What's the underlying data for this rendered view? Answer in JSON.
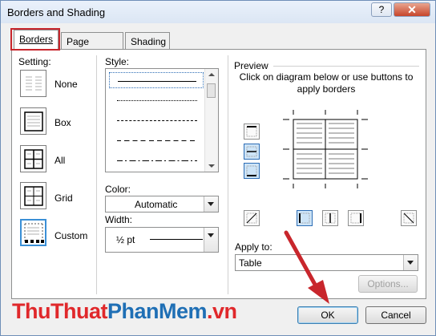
{
  "window": {
    "title": "Borders and Shading",
    "help_label": "?",
    "close_label": "✕"
  },
  "tabs": [
    {
      "label": "Borders",
      "active": true
    },
    {
      "label": "Page Border",
      "active": false
    },
    {
      "label": "Shading",
      "active": false
    }
  ],
  "setting": {
    "label": "Setting:",
    "items": [
      {
        "label": "None",
        "icon": "border-none-icon"
      },
      {
        "label": "Box",
        "icon": "border-box-icon"
      },
      {
        "label": "All",
        "icon": "border-all-icon"
      },
      {
        "label": "Grid",
        "icon": "border-grid-icon"
      },
      {
        "label": "Custom",
        "icon": "border-custom-icon",
        "selected": true
      }
    ]
  },
  "style": {
    "label": "Style:",
    "selected_index": 0
  },
  "color": {
    "label": "Color:",
    "value": "Automatic"
  },
  "width": {
    "label": "Width:",
    "value": "½ pt"
  },
  "preview": {
    "label": "Preview",
    "instruction": "Click on diagram below or use buttons to apply borders"
  },
  "apply_to": {
    "label": "Apply to:",
    "value": "Table"
  },
  "buttons": {
    "options": "Options...",
    "ok": "OK",
    "cancel": "Cancel"
  },
  "watermark": {
    "part1": "ThuThuat",
    "part2": "PhanMem",
    "part3": ".vn"
  },
  "colors": {
    "highlight": "#c8262c",
    "selection": "#3a8fd6",
    "arrow": "#c8262c"
  }
}
